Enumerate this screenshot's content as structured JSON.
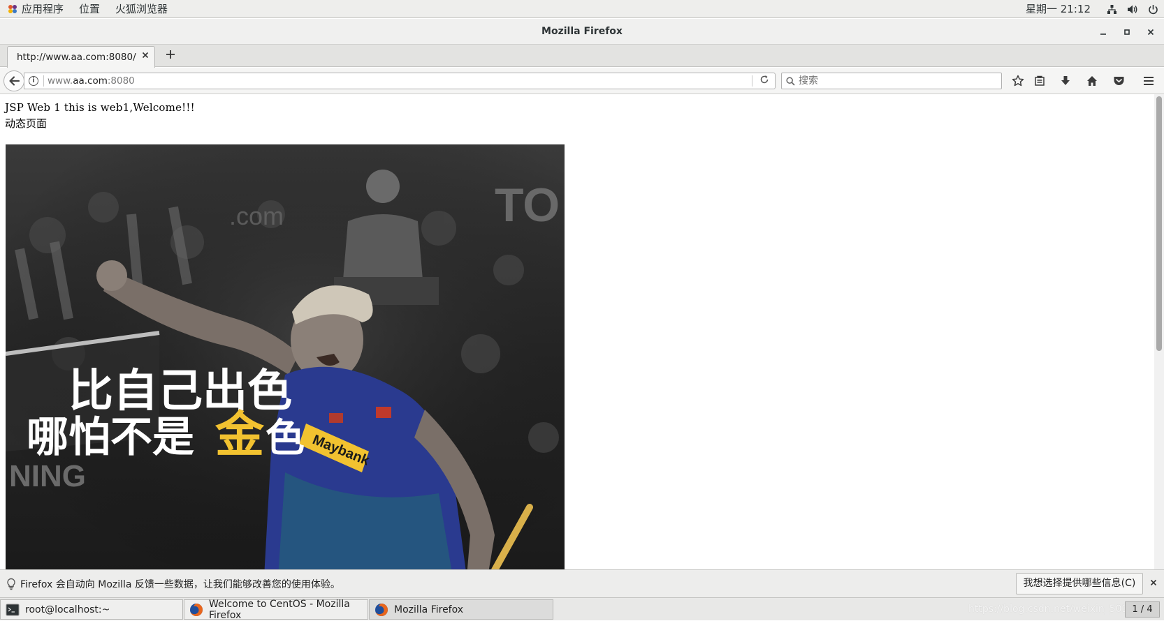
{
  "topbar": {
    "menus": [
      "应用程序",
      "位置",
      "火狐浏览器"
    ],
    "clock": "星期一 21:12",
    "icons": [
      "network-icon",
      "volume-icon",
      "power-icon"
    ]
  },
  "window": {
    "title": "Mozilla Firefox"
  },
  "tabs": [
    {
      "label": "http://www.aa.com:8080/"
    }
  ],
  "navbar": {
    "url_host_prefix": "www.",
    "url_host": "aa.com",
    "url_port": ":8080",
    "search_placeholder": "搜索"
  },
  "page": {
    "line1": "JSP Web 1 this is web1,Welcome!!!",
    "line2": "动态页面",
    "photo_caption_line1": "比自己出色",
    "photo_caption_line2a": "哪怕不是",
    "photo_caption_gold": "金",
    "photo_caption_line2b": "色",
    "photo_brand": "Maybank",
    "photo_sign_left": "NING",
    "photo_sign_top": "TO",
    "photo_sign_com": ".com"
  },
  "notification": {
    "message": "Firefox 会自动向 Mozilla 反馈一些数据，让我们能够改善您的使用体验。",
    "choose_button": "我想选择提供哪些信息(C)"
  },
  "taskbar": {
    "items": [
      {
        "label": "root@localhost:~"
      },
      {
        "label": "Welcome to CentOS - Mozilla Firefox"
      },
      {
        "label": "Mozilla Firefox"
      }
    ],
    "pager": "1 / 4",
    "watermark": "https://blog.csdn.net/weixin_50344"
  },
  "colors": {
    "chrome_bg": "#eeeeec",
    "caption_white": "#ffffff",
    "caption_gold": "#f2c230",
    "jersey_blue": "#2a3a8f"
  }
}
